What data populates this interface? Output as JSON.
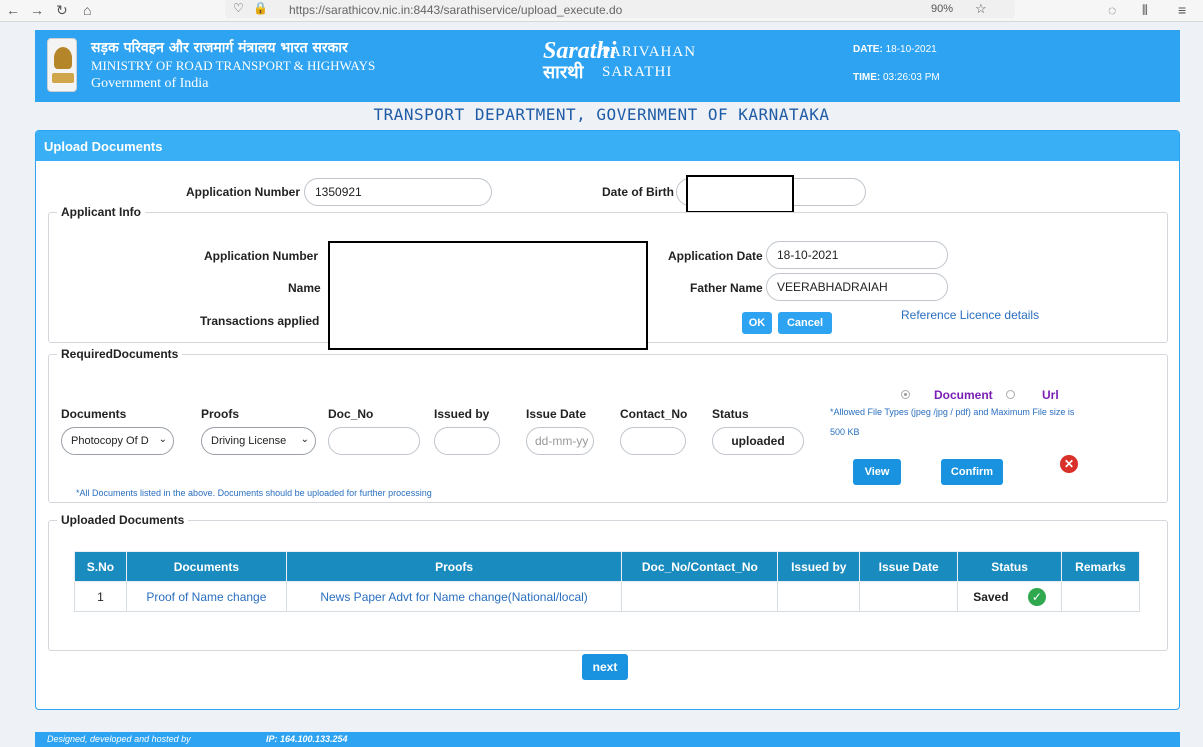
{
  "browser": {
    "url": "https://sarathicov.nic.in:8443/sarathiservice/upload_execute.do",
    "zoom": "90%"
  },
  "header": {
    "ministry_hindi": "सड़क परिवहन और राजमार्ग मंत्रालय भारत सरकार",
    "ministry_english": "MINISTRY OF ROAD TRANSPORT & HIGHWAYS",
    "government": "Government of India",
    "logo_text": "Sarathi",
    "logo_hindi": "सारथी",
    "parivahan": "PARIVAHAN",
    "sarathi": "SARATHI",
    "date_label": "DATE:",
    "date_value": "18-10-2021",
    "time_label": "TIME:",
    "time_value": "03:26:03 PM"
  },
  "department_title": "TRANSPORT DEPARTMENT, GOVERNMENT OF KARNATAKA",
  "panel": {
    "title": "Upload Documents",
    "search": {
      "application_number_label": "Application Number",
      "application_number_value": "1350921",
      "dob_label": "Date of Birth"
    },
    "applicant_info": {
      "legend": "Applicant Info",
      "application_number_label": "Application Number",
      "name_label": "Name",
      "transactions_label": "Transactions applied",
      "application_date_label": "Application Date",
      "application_date_value": "18-10-2021",
      "father_name_label": "Father Name",
      "father_name_value": "VEERABHADRAIAH",
      "ok_label": "OK",
      "cancel_label": "Cancel",
      "reference_link": "Reference Licence details"
    },
    "required": {
      "legend": "RequiredDocuments",
      "col_documents": "Documents",
      "col_proofs": "Proofs",
      "col_doc_no": "Doc_No",
      "col_issued_by": "Issued by",
      "col_issue_date": "Issue Date",
      "col_contact_no": "Contact_No",
      "col_status": "Status",
      "documents_value": "Photocopy Of D",
      "proofs_value": "Driving License",
      "issue_date_placeholder": "dd-mm-yy",
      "status_value": "uploaded",
      "radio_document": "Document",
      "radio_url": "Url",
      "allowed_note": "*Allowed File Types (jpeg /jpg / pdf) and Maximum File size is",
      "max_size": "500 KB",
      "view_label": "View",
      "confirm_label": "Confirm",
      "footnote": "*All Documents listed in the above. Documents should be uploaded for further processing"
    },
    "uploaded": {
      "legend": "Uploaded Documents",
      "headers": [
        "S.No",
        "Documents",
        "Proofs",
        "Doc_No/Contact_No",
        "Issued by",
        "Issue  Date",
        "Status",
        "Remarks"
      ],
      "rows": [
        {
          "sno": "1",
          "document": "Proof of Name change",
          "proof": "News Paper Advt for Name change(National/local)",
          "doc_no": "",
          "issued_by": "",
          "issue_date": "",
          "status": "Saved",
          "remarks": ""
        }
      ]
    },
    "next_label": "next"
  },
  "footer": {
    "designed": "Designed, developed and hosted by",
    "ip": "IP: 164.100.133.254"
  }
}
